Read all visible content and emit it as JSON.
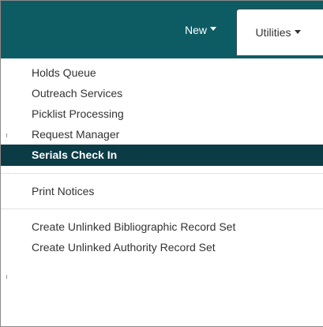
{
  "navbar": {
    "new_label": "New",
    "utilities_label": "Utilities",
    "bg_color": "#0d5c64"
  },
  "dropdown": {
    "group1": [
      "Holds Queue",
      "Outreach Services",
      "Picklist Processing",
      "Request Manager",
      "Serials Check In"
    ],
    "active_item": "Serials Check In",
    "active_color": "#0b3b45",
    "group2": [
      "Print Notices"
    ],
    "group3": [
      "Create Unlinked Bibliographic Record Set",
      "Create Unlinked Authority Record Set"
    ]
  }
}
